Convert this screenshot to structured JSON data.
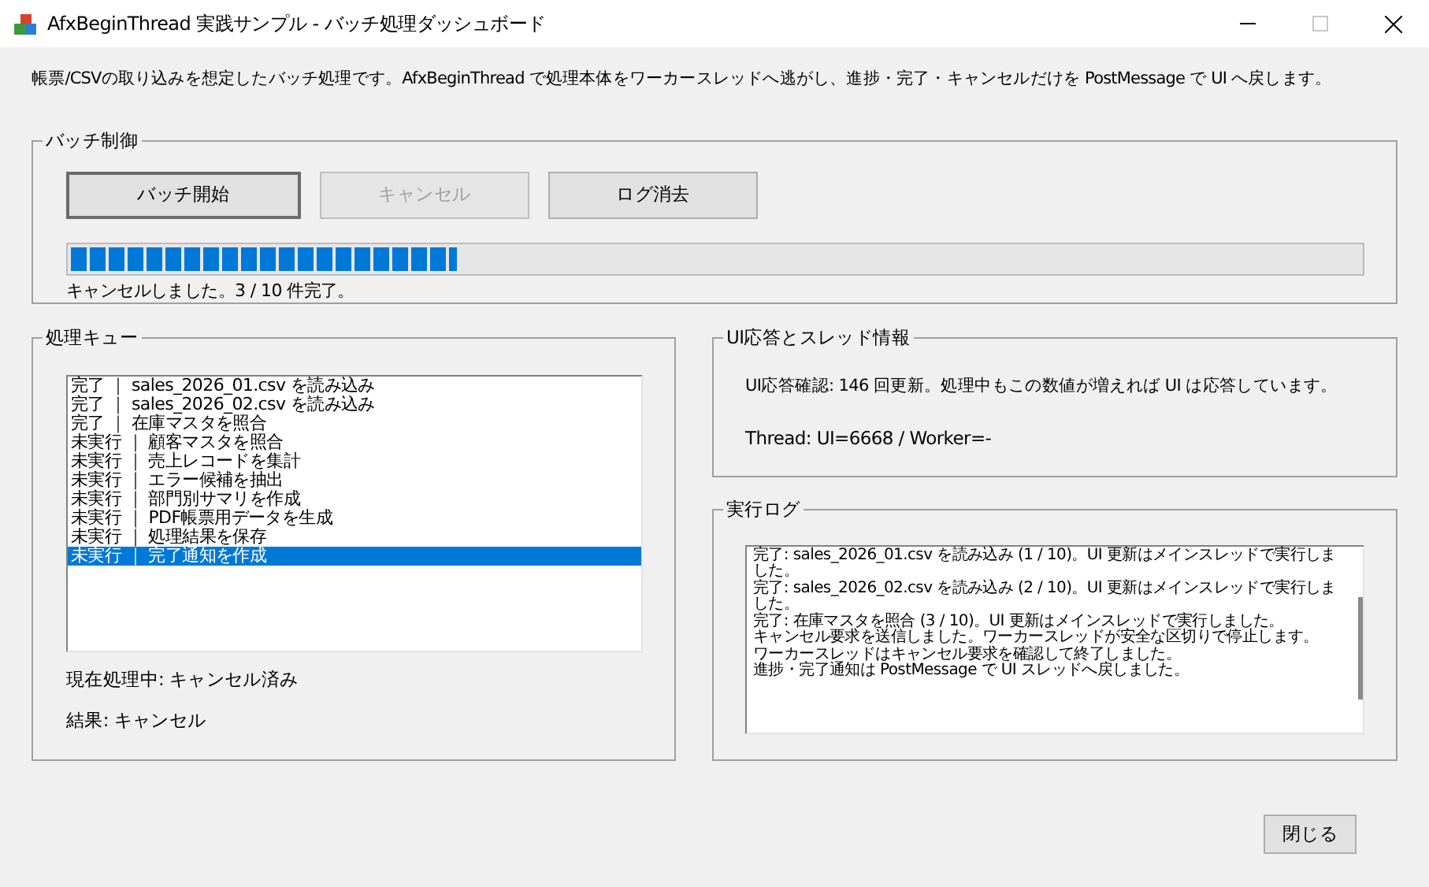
{
  "window": {
    "title": "AfxBeginThread 実践サンプル - バッチ処理ダッシュボード",
    "maximize_disabled": true
  },
  "description": "帳票/CSVの取り込みを想定したバッチ処理です。AfxBeginThread で処理本体をワーカースレッドへ逃がし、進捗・完了・キャンセルだけを PostMessage で UI へ戻します。",
  "batch_control": {
    "title": "バッチ制御",
    "buttons": [
      {
        "label": "バッチ開始",
        "disabled": false,
        "default": true
      },
      {
        "label": "キャンセル",
        "disabled": true,
        "default": false
      },
      {
        "label": "ログ消去",
        "disabled": false,
        "default": false
      }
    ],
    "progress": {
      "level": 0.3
    },
    "status": "キャンセルしました。3 / 10 件完了。"
  },
  "queue": {
    "title": "処理キュー",
    "items": [
      {
        "text": "完了 ｜ sales_2026_01.csv を読み込み",
        "selected": false
      },
      {
        "text": "完了 ｜ sales_2026_02.csv を読み込み",
        "selected": false
      },
      {
        "text": "完了 ｜ 在庫マスタを照合",
        "selected": false
      },
      {
        "text": "未実行 ｜ 顧客マスタを照合",
        "selected": false
      },
      {
        "text": "未実行 ｜ 売上レコードを集計",
        "selected": false
      },
      {
        "text": "未実行 ｜ エラー候補を抽出",
        "selected": false
      },
      {
        "text": "未実行 ｜ 部門別サマリを作成",
        "selected": false
      },
      {
        "text": "未実行 ｜ PDF帳票用データを生成",
        "selected": false
      },
      {
        "text": "未実行 ｜ 処理結果を保存",
        "selected": false
      },
      {
        "text": "未実行 ｜ 完了通知を作成",
        "selected": true
      }
    ],
    "current": "現在処理中: キャンセル済み",
    "result": "結果: キャンセル"
  },
  "ui_info": {
    "title": "UI応答とスレッド情報",
    "response": "UI応答確認: 146 回更新。処理中もこの数値が増えれば UI は応答しています。",
    "thread": "Thread: UI=6668 / Worker=-"
  },
  "log": {
    "title": "実行ログ",
    "lines": [
      "完了: sales_2026_01.csv を読み込み (1 / 10)。UI 更新はメインスレッドで実行しました。",
      "完了: sales_2026_02.csv を読み込み (2 / 10)。UI 更新はメインスレッドで実行しました。",
      "完了: 在庫マスタを照合 (3 / 10)。UI 更新はメインスレッドで実行しました。",
      "キャンセル要求を送信しました。ワーカースレッドが安全な区切りで停止します。",
      "ワーカースレッドはキャンセル要求を確認して終了しました。",
      "進捗・完了通知は PostMessage で UI スレッドへ戻しました。"
    ]
  },
  "close_button": {
    "label": "閉じる"
  }
}
